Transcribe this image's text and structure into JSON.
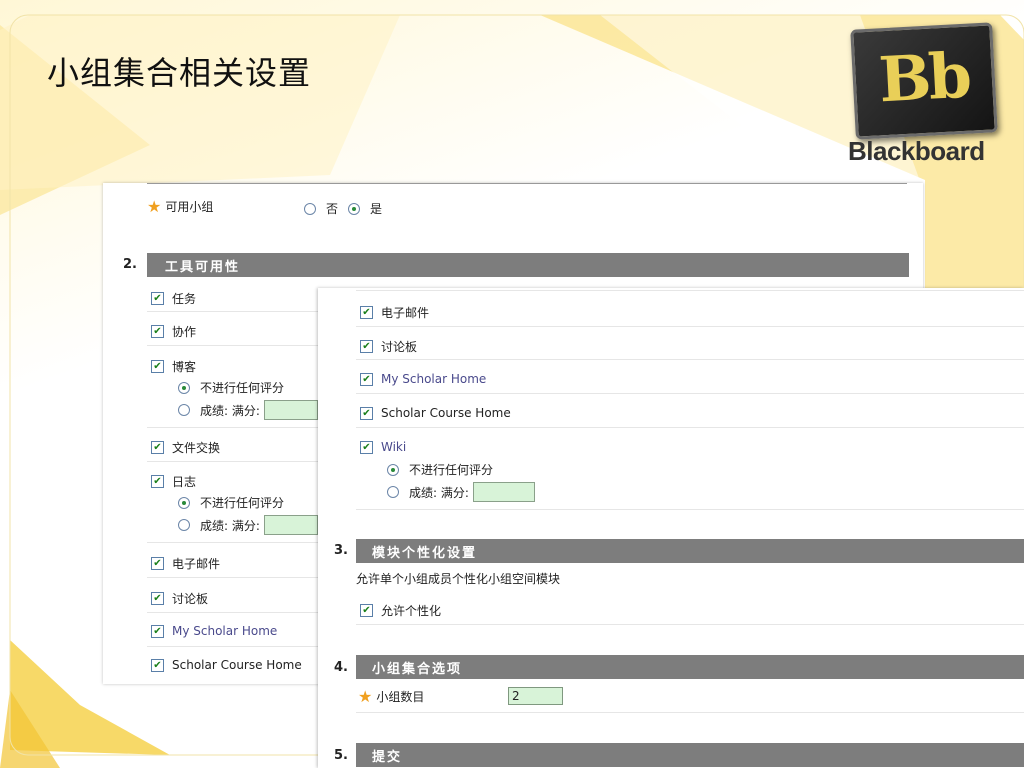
{
  "slide": {
    "title": "小组集合相关设置"
  },
  "logo": {
    "monogram": "Bb",
    "wordmark": "Blackboard"
  },
  "colors": {
    "section_bar": "#7d7d7d",
    "field_fill": "#d8f3d8",
    "star": "#f0a020",
    "accent_yellow": "#f8d44a"
  },
  "panel_left": {
    "available": {
      "label": "可用小组",
      "opt_no": "否",
      "opt_yes": "是",
      "selected": "是"
    },
    "section2": {
      "number": "2.",
      "title": "工具可用性"
    },
    "tools": {
      "task": "任务",
      "collab": "协作",
      "blog": "博客",
      "blog_nograde": "不进行任何评分",
      "blog_grade": "成绩: 满分:",
      "exchange": "文件交换",
      "journal": "日志",
      "journal_nograde": "不进行任何评分",
      "journal_grade": "成绩: 满分:",
      "email": "电子邮件",
      "discussion": "讨论板",
      "myscholar": "My Scholar Home",
      "scholarcourse": "Scholar Course Home"
    }
  },
  "panel_right": {
    "tools": {
      "email": "电子邮件",
      "discussion": "讨论板",
      "myscholar": "My Scholar Home",
      "scholarcourse": "Scholar Course Home",
      "wiki": "Wiki",
      "wiki_nograde": "不进行任何评分",
      "wiki_grade": "成绩: 满分:"
    },
    "section3": {
      "number": "3.",
      "title": "模块个性化设置",
      "desc": "允许单个小组成员个性化小组空间模块",
      "allow": "允许个性化"
    },
    "section4": {
      "number": "4.",
      "title": "小组集合选项",
      "count_label": "小组数目",
      "count_value": "2"
    },
    "section5": {
      "number": "5.",
      "title": "提交"
    }
  }
}
